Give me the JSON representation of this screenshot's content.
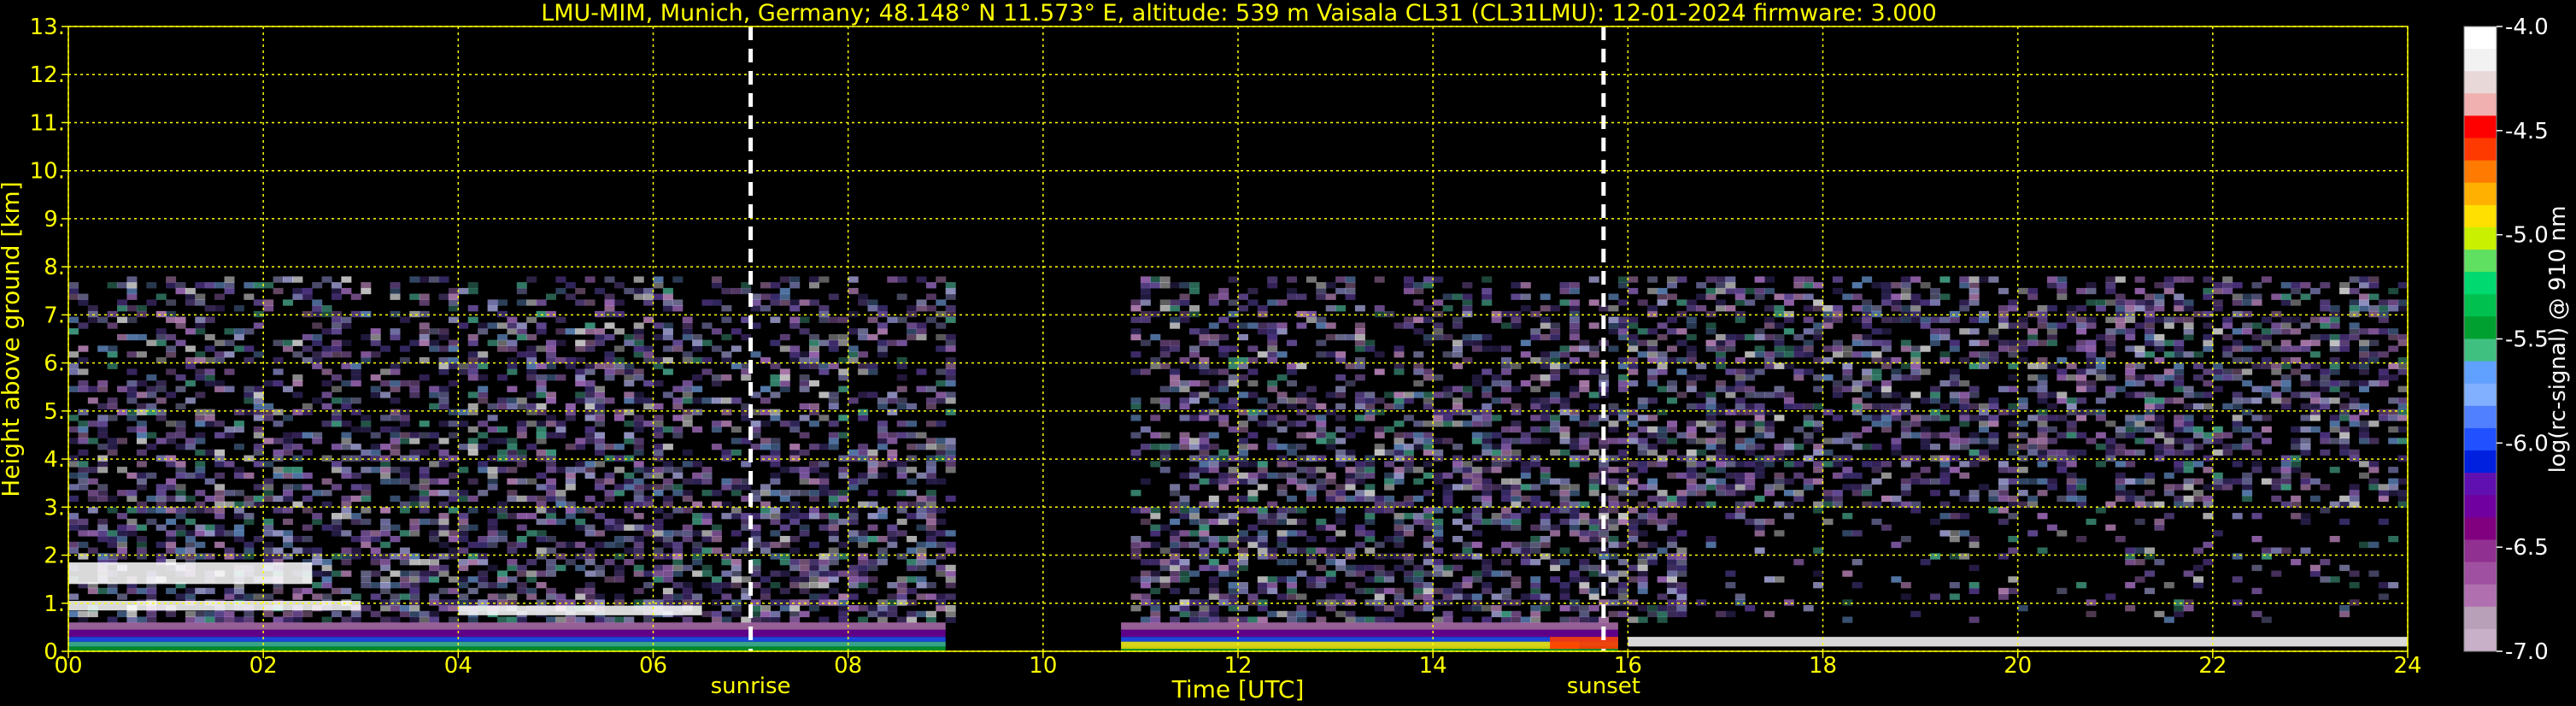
{
  "chart_data": {
    "type": "heatmap",
    "title": "LMU-MIM, Munich, Germany; 48.148° N 11.573° E, altitude: 539 m    Vaisala CL31 (CL31LMU): 12-01-2024    firmware: 3.000",
    "xlabel": "Time [UTC]",
    "ylabel": "Height above ground [km]",
    "xlim": [
      0,
      24
    ],
    "ylim": [
      0,
      13
    ],
    "x_ticks": [
      0,
      2,
      4,
      6,
      8,
      10,
      12,
      14,
      16,
      18,
      20,
      22,
      24
    ],
    "x_tick_labels": [
      "00",
      "02",
      "04",
      "06",
      "08",
      "10",
      "12",
      "14",
      "16",
      "18",
      "20",
      "22",
      "24"
    ],
    "y_ticks": [
      0,
      1,
      2,
      3,
      4,
      5,
      6,
      7,
      8,
      9,
      10,
      11,
      12,
      13
    ],
    "y_tick_labels": [
      "0.",
      "1.",
      "2.",
      "3.",
      "4.",
      "5.",
      "6.",
      "7.",
      "8.",
      "9.",
      "10.",
      "11.",
      "12.",
      "13."
    ],
    "grid": true,
    "grid_color": "#ffff00",
    "annotations": [
      {
        "label": "sunrise",
        "x": 7.0
      },
      {
        "label": "sunset",
        "x": 15.75
      }
    ],
    "signal_ceiling_km": 7.7,
    "data_gap_hours": [
      9.0,
      10.8
    ],
    "colorbar": {
      "label": "log(rc-signal) @ 910 nm",
      "min": -7.0,
      "max": -4.0,
      "ticks": [
        -4.0,
        -4.5,
        -5.0,
        -5.5,
        -6.0,
        -6.5,
        -7.0
      ],
      "tick_labels": [
        "-4.0",
        "-4.5",
        "-5.0",
        "-5.5",
        "-6.0",
        "-6.5",
        "-7.0"
      ],
      "colors": [
        "#ffffff",
        "#f2f2f2",
        "#e8d8d8",
        "#f0b0b0",
        "#ff0000",
        "#ff3a00",
        "#ff7a00",
        "#ffb000",
        "#ffe000",
        "#c8f000",
        "#60e060",
        "#00d870",
        "#00c050",
        "#00a030",
        "#40c080",
        "#60a0ff",
        "#80b0ff",
        "#5080ff",
        "#2050ff",
        "#0020e0",
        "#6010b0",
        "#7000a0",
        "#800080",
        "#903090",
        "#a050a0",
        "#b070b0",
        "#b8a0b8",
        "#c8b0c8"
      ]
    },
    "layers": [
      {
        "name": "boundary layer aerosol",
        "x": [
          0,
          24
        ],
        "y_km": [
          0.0,
          0.45
        ]
      },
      {
        "name": "cloud layer",
        "x": [
          0.0,
          3.0
        ],
        "y_km": [
          0.85,
          1.05
        ]
      },
      {
        "name": "cloud layer",
        "x": [
          4.0,
          6.5
        ],
        "y_km": [
          0.75,
          0.95
        ]
      },
      {
        "name": "cloud fragments",
        "x": [
          0.0,
          2.5
        ],
        "y_km": [
          1.4,
          1.85
        ]
      },
      {
        "name": "low cloud",
        "x": [
          16.0,
          24.0
        ],
        "y_km": [
          0.1,
          0.3
        ]
      }
    ]
  }
}
